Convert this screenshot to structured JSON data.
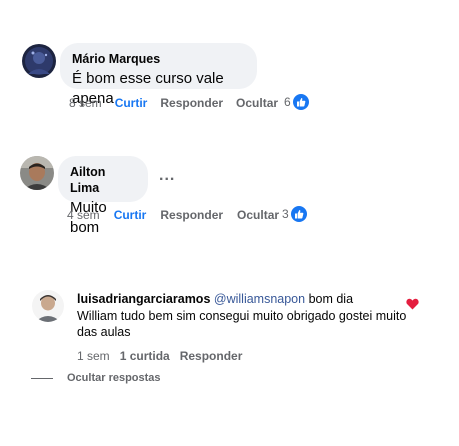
{
  "comments": [
    {
      "author": "Mário Marques",
      "text": "É bom esse curso vale apena",
      "time": "8 sem",
      "like_label": "Curtir",
      "reply_label": "Responder",
      "hide_label": "Ocultar",
      "reaction_count": "6"
    },
    {
      "author": "Ailton Lima",
      "text": "Muito bom",
      "more_label": "...",
      "time": "4 sem",
      "like_label": "Curtir",
      "reply_label": "Responder",
      "hide_label": "Ocultar",
      "reaction_count": "3"
    }
  ],
  "reply": {
    "author": "luisadriangarciaramos",
    "mention": "@williamsnapon",
    "text_first": " bom dia",
    "text_rest": "William tudo bem sim consegui muito obrigado gostei muito das aulas",
    "time": "1 sem",
    "likes_label": "1 curtida",
    "reply_label": "Responder",
    "heart_icon": "heart-icon"
  },
  "hide_replies_label": "Ocultar respostas",
  "colors": {
    "bubble": "#f0f2f5",
    "like_blue": "#1877f2",
    "mention_blue": "#385898",
    "heart_red": "#e41e3f",
    "secondary_text": "#65676b"
  }
}
